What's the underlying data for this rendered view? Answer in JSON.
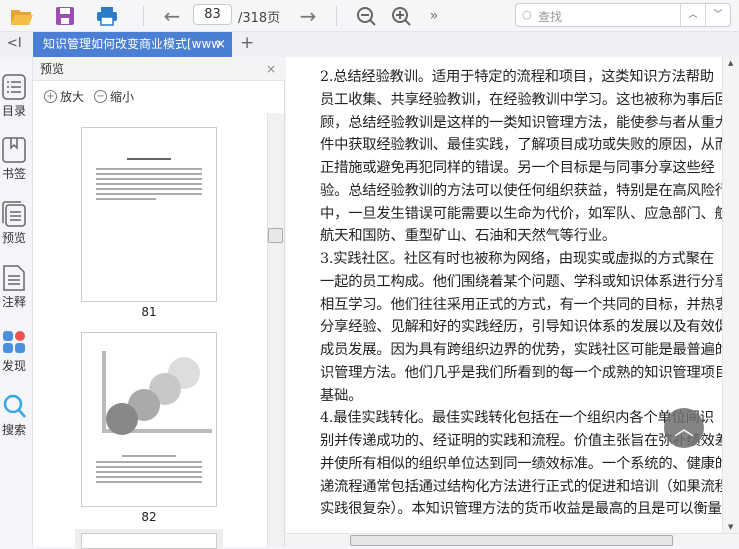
{
  "toolbar": {
    "current_page": "83",
    "total_pages": "/318页",
    "search_placeholder": "查找",
    "more": "»"
  },
  "tabs": [
    {
      "label": "知识管理如何改变商业模式[www",
      "close": "×"
    }
  ],
  "tab_add": "+",
  "collapse": "<I",
  "rail": [
    {
      "label": "目录"
    },
    {
      "label": "书签"
    },
    {
      "label": "预览"
    },
    {
      "label": "注释"
    },
    {
      "label": "发现"
    },
    {
      "label": "搜索"
    }
  ],
  "preview": {
    "title": "预览",
    "close": "×",
    "zoom_in": "放大",
    "zoom_out": "缩小",
    "thumbnails": [
      {
        "page": "81"
      },
      {
        "page": "82"
      }
    ]
  },
  "document": {
    "lines": [
      "2.总结经验教训。适用于特定的流程和项目，这类知识方法帮助",
      "员工收集、共享经验教训，在经验教训中学习。这也被称为事后回",
      "顾，总结经验教训是这样的一类知识管理方法，能使参与者从重大事",
      "件中获取经验教训、最佳实践，了解项目成功或失败的原因，从而纠",
      "正措施或避免再犯同样的错误。另一个目标是与同事分享这些经",
      "验。总结经验教训的方法可以使任何组织获益，特别是在高风险行业",
      "中，一旦发生错误可能需要以生命为代价，如军队、应急部门、航空",
      "航天和国防、重型矿山、石油和天然气等行业。",
      "3.实践社区。社区有时也被称为网络，由现实或虚拟的方式聚在",
      "一起的员工构成。他们围绕着某个问题、学科或知识体系进行分享和",
      "相互学习。他们往往采用正式的方式，有一个共同的目标，并热衷于",
      "分享经验、见解和好的实践经历，引导知识体系的发展以及有效促进",
      "成员发展。因为具有跨组织边界的优势，实践社区可能是最普遍的知",
      "识管理方法。他们几乎是我们所看到的每一个成熟的知识管理项目的",
      "基础。",
      "4.最佳实践转化。最佳实践转化包括在一个组织内各个单位间识",
      "别并传递成功的、经证明的实践和流程。价值主张旨在弥补绩效差异",
      "并使所有相似的组织单位达到同一绩效标准。一个系统的、健康的传",
      "递流程通常包括通过结构化方法进行正式的促进和培训（如果流程或",
      "实践很复杂）。本知识管理方法的货币收益是最高的且是可以衡量"
    ]
  }
}
